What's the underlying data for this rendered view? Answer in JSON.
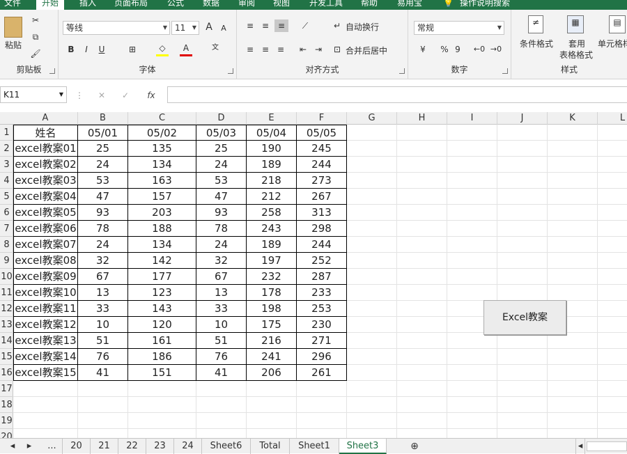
{
  "ribbon_tabs": [
    "文件",
    "开始",
    "插入",
    "页面布局",
    "公式",
    "数据",
    "审阅",
    "视图",
    "开发工具",
    "帮助",
    "易用宝",
    "操作说明搜索"
  ],
  "ribbon": {
    "clipboard": {
      "label": "剪贴板",
      "paste": "粘贴"
    },
    "font": {
      "label": "字体",
      "font_name": "等线",
      "font_size": "11",
      "bold": "B",
      "italic": "I",
      "underline": "U",
      "grow": "A",
      "shrink": "A"
    },
    "alignment": {
      "label": "对齐方式",
      "wrap": "自动换行",
      "merge": "合并后居中"
    },
    "number": {
      "label": "数字",
      "format": "常规",
      "percent": "%",
      "comma": "9"
    },
    "styles": {
      "label": "样式",
      "conditional": "条件格式",
      "table_line1": "套用",
      "table_line2": "表格格式",
      "cell_styles": "单元格样"
    }
  },
  "formula_bar": {
    "name_box": "K11",
    "formula": ""
  },
  "columns": [
    "A",
    "B",
    "C",
    "D",
    "E",
    "F",
    "G",
    "H",
    "I",
    "J",
    "K",
    "L"
  ],
  "rows": [
    "1",
    "2",
    "3",
    "4",
    "5",
    "6",
    "7",
    "8",
    "9",
    "10",
    "11",
    "12",
    "13",
    "14",
    "15",
    "16",
    "17",
    "18",
    "19",
    "20"
  ],
  "table": {
    "headers": [
      "姓名",
      "05/01",
      "05/02",
      "05/03",
      "05/04",
      "05/05"
    ],
    "rows": [
      [
        "excel教案01",
        "25",
        "135",
        "25",
        "190",
        "245"
      ],
      [
        "excel教案02",
        "24",
        "134",
        "24",
        "189",
        "244"
      ],
      [
        "excel教案03",
        "53",
        "163",
        "53",
        "218",
        "273"
      ],
      [
        "excel教案04",
        "47",
        "157",
        "47",
        "212",
        "267"
      ],
      [
        "excel教案05",
        "93",
        "203",
        "93",
        "258",
        "313"
      ],
      [
        "excel教案06",
        "78",
        "188",
        "78",
        "243",
        "298"
      ],
      [
        "excel教案07",
        "24",
        "134",
        "24",
        "189",
        "244"
      ],
      [
        "excel教案08",
        "32",
        "142",
        "32",
        "197",
        "252"
      ],
      [
        "excel教案09",
        "67",
        "177",
        "67",
        "232",
        "287"
      ],
      [
        "excel教案10",
        "13",
        "123",
        "13",
        "178",
        "233"
      ],
      [
        "excel教案11",
        "33",
        "143",
        "33",
        "198",
        "253"
      ],
      [
        "excel教案12",
        "10",
        "120",
        "10",
        "175",
        "230"
      ],
      [
        "excel教案13",
        "51",
        "161",
        "51",
        "216",
        "271"
      ],
      [
        "excel教案14",
        "76",
        "186",
        "76",
        "241",
        "296"
      ],
      [
        "excel教案15",
        "41",
        "151",
        "41",
        "206",
        "261"
      ]
    ]
  },
  "button": {
    "label": "Excel教案"
  },
  "sheet_tabs": [
    "20",
    "21",
    "22",
    "23",
    "24",
    "Sheet6",
    "Total",
    "Sheet1",
    "Sheet3"
  ],
  "active_sheet": "Sheet3",
  "colors": {
    "accent": "#217346"
  }
}
